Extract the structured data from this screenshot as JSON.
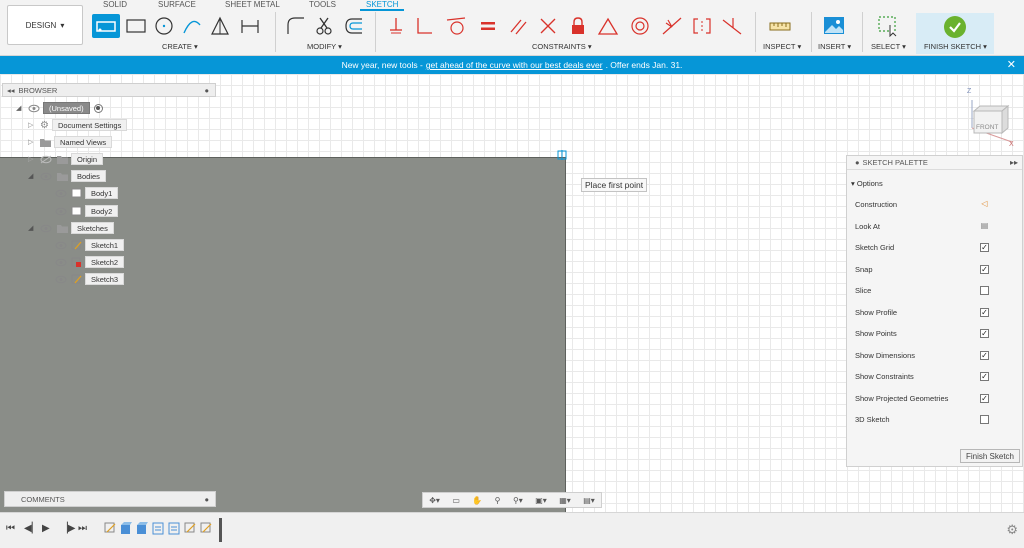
{
  "toolbar": {
    "design_label": "DESIGN",
    "tabs": [
      "SOLID",
      "SURFACE",
      "SHEET METAL",
      "TOOLS",
      "SKETCH"
    ],
    "active_tab": "SKETCH",
    "groups": {
      "create": "CREATE",
      "modify": "MODIFY",
      "constraints": "CONSTRAINTS",
      "inspect": "INSPECT",
      "insert": "INSERT",
      "select": "SELECT",
      "finish_sketch": "FINISH SKETCH"
    },
    "colors": {
      "accent": "#0696d7",
      "constraint_red": "#d9322b",
      "finish_green": "#6ab22e"
    }
  },
  "banner": {
    "text_before": "New year, new tools -",
    "link_text": "get ahead of the curve with our best deals ever",
    "text_after": ". Offer ends Jan. 31.",
    "close": "✕"
  },
  "browser": {
    "title": "BROWSER",
    "items": [
      {
        "label": "(Unsaved)"
      },
      {
        "label": "Document Settings"
      },
      {
        "label": "Named Views"
      },
      {
        "label": "Origin"
      },
      {
        "label": "Bodies"
      },
      {
        "label": "Body1"
      },
      {
        "label": "Body2"
      },
      {
        "label": "Sketches"
      },
      {
        "label": "Sketch1"
      },
      {
        "label": "Sketch2"
      },
      {
        "label": "Sketch3"
      }
    ]
  },
  "canvas": {
    "tooltip": "Place first point",
    "viewcube_label": "FRONT",
    "axis_z": "Z",
    "axis_x": "X"
  },
  "palette": {
    "title": "SKETCH PALETTE",
    "section": "Options",
    "finish_button": "Finish Sketch",
    "options": [
      {
        "label": "Construction",
        "type": "icon"
      },
      {
        "label": "Look At",
        "type": "icon"
      },
      {
        "label": "Sketch Grid",
        "checked": true
      },
      {
        "label": "Snap",
        "checked": true
      },
      {
        "label": "Slice",
        "checked": false
      },
      {
        "label": "Show Profile",
        "checked": true
      },
      {
        "label": "Show Points",
        "checked": true
      },
      {
        "label": "Show Dimensions",
        "checked": true
      },
      {
        "label": "Show Constraints",
        "checked": true
      },
      {
        "label": "Show Projected Geometries",
        "checked": true
      },
      {
        "label": "3D Sketch",
        "checked": false
      }
    ]
  },
  "comments": {
    "title": "COMMENTS"
  }
}
